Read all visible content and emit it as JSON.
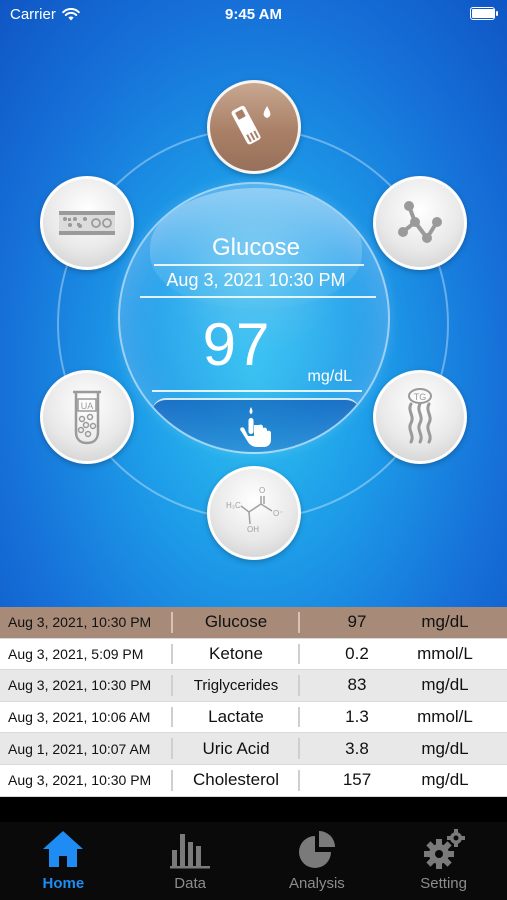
{
  "status_bar": {
    "carrier": "Carrier",
    "time": "9:45 AM",
    "battery_level": 1.0
  },
  "dial": {
    "title": "Glucose",
    "datetime": "Aug 3, 2021 10:30 PM",
    "value": "97",
    "unit": "mg/dL"
  },
  "satellites": [
    {
      "name": "glucose",
      "icon": "test-strip-icon",
      "active": true
    },
    {
      "name": "cholesterol",
      "icon": "molecule-icon",
      "active": false
    },
    {
      "name": "triglycerides",
      "icon": "tg-icon",
      "active": false
    },
    {
      "name": "lactate",
      "icon": "lactate-formula-icon",
      "active": false
    },
    {
      "name": "uric-acid",
      "icon": "ua-tube-icon",
      "active": false
    },
    {
      "name": "ketone",
      "icon": "blood-vessel-icon",
      "active": false
    }
  ],
  "lactate_formula": {
    "h3c": "H₃C",
    "o": "O",
    "oh": "OH",
    "ominus": "O⁻"
  },
  "tg_label": "TG",
  "ua_label": "UA",
  "records": [
    {
      "datetime": "Aug 3, 2021, 10:30 PM",
      "type": "Glucose",
      "value": "97",
      "unit": "mg/dL"
    },
    {
      "datetime": "Aug 3, 2021, 5:09 PM",
      "type": "Ketone",
      "value": "0.2",
      "unit": "mmol/L"
    },
    {
      "datetime": "Aug 3, 2021, 10:30 PM",
      "type": "Triglycerides",
      "value": "83",
      "unit": "mg/dL"
    },
    {
      "datetime": "Aug 3, 2021, 10:06 AM",
      "type": "Lactate",
      "value": "1.3",
      "unit": "mmol/L"
    },
    {
      "datetime": "Aug 1, 2021, 10:07 AM",
      "type": "Uric Acid",
      "value": "3.8",
      "unit": "mg/dL"
    },
    {
      "datetime": "Aug 3, 2021, 10:30 PM",
      "type": "Cholesterol",
      "value": "157",
      "unit": "mg/dL"
    }
  ],
  "tabs": [
    {
      "label": "Home",
      "icon": "house-icon",
      "active": true
    },
    {
      "label": "Data",
      "icon": "bar-chart-icon",
      "active": false
    },
    {
      "label": "Analysis",
      "icon": "pie-chart-icon",
      "active": false
    },
    {
      "label": "Setting",
      "icon": "gears-icon",
      "active": false
    }
  ],
  "colors": {
    "accent": "#1e8cf2",
    "selected_row": "#a88a78",
    "active_satellite": "#a98067",
    "background_blue": "#1670d8"
  }
}
